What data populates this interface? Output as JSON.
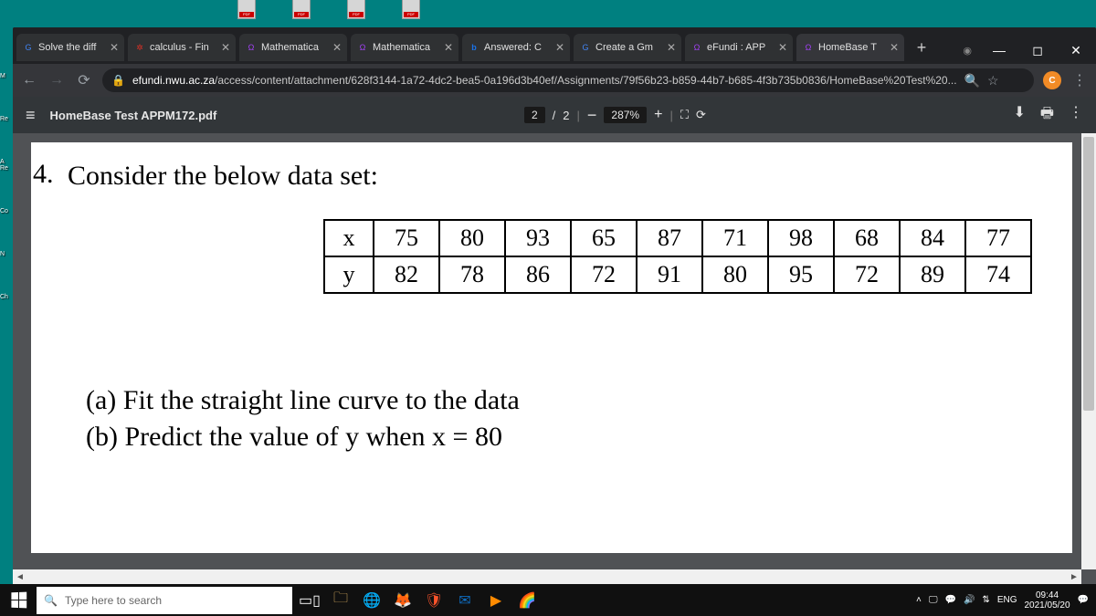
{
  "tabs": [
    {
      "favicon": "G",
      "favcolor": "#4285f4",
      "title": "Solve the diff"
    },
    {
      "favicon": "✲",
      "favcolor": "#d93025",
      "title": "calculus - Fin"
    },
    {
      "favicon": "Ω",
      "favcolor": "#a142f4",
      "title": "Mathematica"
    },
    {
      "favicon": "Ω",
      "favcolor": "#a142f4",
      "title": "Mathematica"
    },
    {
      "favicon": "b",
      "favcolor": "#1a73e8",
      "title": "Answered: C"
    },
    {
      "favicon": "G",
      "favcolor": "#4285f4",
      "title": "Create a Gm"
    },
    {
      "favicon": "Ω",
      "favcolor": "#a142f4",
      "title": "eFundi : APP"
    },
    {
      "favicon": "Ω",
      "favcolor": "#a142f4",
      "title": "HomeBase T"
    }
  ],
  "window_controls": {
    "min": "—",
    "max": "◻",
    "close": "✕"
  },
  "navigation": {
    "back": "←",
    "forward": "→",
    "reload": "⟳"
  },
  "url_host": "efundi.nwu.ac.za",
  "url_path": "/access/content/attachment/628f3144-1a72-4dc2-bea5-0a196d3b40ef/Assignments/79f56b23-b859-44b7-b685-4f3b735b0836/HomeBase%20Test%20...",
  "url_icons": {
    "lock": "🔒",
    "zoom": "🔍",
    "star": "☆",
    "profile": "C",
    "menu": "⋮"
  },
  "pdf_toolbar": {
    "hamburger": "≡",
    "doc_title": "HomeBase Test APPM172.pdf",
    "page": "2",
    "page_sep": " / ",
    "total": "2",
    "zoom_minus": "−",
    "zoom_val": "287%",
    "zoom_plus": "+",
    "fit": "⛶",
    "rotate": "⟳",
    "download": "⬇",
    "print": "🖶",
    "more": "⋮"
  },
  "question": {
    "number": "4.",
    "title": "Consider the below data set:",
    "row1_label": "x",
    "row1": [
      "75",
      "80",
      "93",
      "65",
      "87",
      "71",
      "98",
      "68",
      "84",
      "77"
    ],
    "row2_label": "y",
    "row2": [
      "82",
      "78",
      "86",
      "72",
      "91",
      "80",
      "95",
      "72",
      "89",
      "74"
    ],
    "part_a": "(a)  Fit the straight line curve to the data",
    "part_b": "(b)  Predict the value of y when x = 80"
  },
  "taskbar": {
    "search_placeholder": "Type here to search",
    "search_icon": "🔍",
    "tray": {
      "up": "˄",
      "proj": "🖵",
      "disp": "💬",
      "vol": "🔊",
      "sync": "⇅",
      "lang": "ENG",
      "time": "09:44",
      "date": "2021/05/20",
      "note": "💬"
    }
  },
  "chart_data": {
    "type": "table",
    "title": "Question 4 data set (x vs y)",
    "columns": [
      "x",
      "y"
    ],
    "rows": [
      [
        75,
        82
      ],
      [
        80,
        78
      ],
      [
        93,
        86
      ],
      [
        65,
        72
      ],
      [
        87,
        91
      ],
      [
        71,
        80
      ],
      [
        98,
        95
      ],
      [
        68,
        72
      ],
      [
        84,
        89
      ],
      [
        77,
        74
      ]
    ]
  }
}
